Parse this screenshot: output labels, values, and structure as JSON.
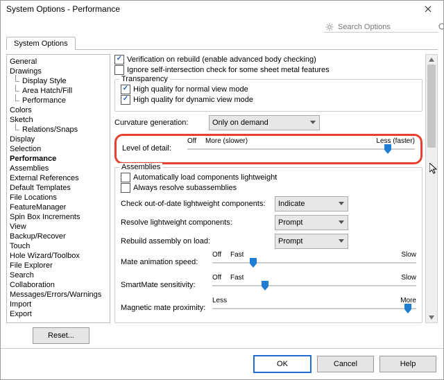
{
  "window": {
    "title": "System Options - Performance"
  },
  "search": {
    "placeholder": "Search Options"
  },
  "tabs": {
    "main": "System Options"
  },
  "tree": [
    {
      "label": "General",
      "depth": 0
    },
    {
      "label": "Drawings",
      "depth": 0
    },
    {
      "label": "Display Style",
      "depth": 1
    },
    {
      "label": "Area Hatch/Fill",
      "depth": 1
    },
    {
      "label": "Performance",
      "depth": 1
    },
    {
      "label": "Colors",
      "depth": 0
    },
    {
      "label": "Sketch",
      "depth": 0
    },
    {
      "label": "Relations/Snaps",
      "depth": 1
    },
    {
      "label": "Display",
      "depth": 0
    },
    {
      "label": "Selection",
      "depth": 0
    },
    {
      "label": "Performance",
      "depth": 0,
      "selected": true
    },
    {
      "label": "Assemblies",
      "depth": 0
    },
    {
      "label": "External References",
      "depth": 0
    },
    {
      "label": "Default Templates",
      "depth": 0
    },
    {
      "label": "File Locations",
      "depth": 0
    },
    {
      "label": "FeatureManager",
      "depth": 0
    },
    {
      "label": "Spin Box Increments",
      "depth": 0
    },
    {
      "label": "View",
      "depth": 0
    },
    {
      "label": "Backup/Recover",
      "depth": 0
    },
    {
      "label": "Touch",
      "depth": 0
    },
    {
      "label": "Hole Wizard/Toolbox",
      "depth": 0
    },
    {
      "label": "File Explorer",
      "depth": 0
    },
    {
      "label": "Search",
      "depth": 0
    },
    {
      "label": "Collaboration",
      "depth": 0
    },
    {
      "label": "Messages/Errors/Warnings",
      "depth": 0
    },
    {
      "label": "Import",
      "depth": 0
    },
    {
      "label": "Export",
      "depth": 0
    }
  ],
  "options": {
    "verification": {
      "label": "Verification on rebuild (enable advanced body checking)",
      "checked": true
    },
    "ignore_self": {
      "label": "Ignore self-intersection check for some sheet metal features",
      "checked": false
    },
    "transparency": {
      "legend": "Transparency",
      "hq_normal": {
        "label": "High quality for normal view mode",
        "checked": true
      },
      "hq_dynamic": {
        "label": "High quality for dynamic view mode",
        "checked": true
      }
    },
    "curvature": {
      "label": "Curvature generation:",
      "value": "Only on demand"
    },
    "detail": {
      "label": "Level of detail:",
      "left": "Off",
      "mid": "More (slower)",
      "right": "Less (faster)",
      "value": 88
    },
    "assemblies": {
      "legend": "Assemblies",
      "auto_light": {
        "label": "Automatically load components lightweight",
        "checked": false
      },
      "resolve_sub": {
        "label": "Always resolve subassemblies",
        "checked": false
      },
      "check_out": {
        "label": "Check out-of-date lightweight components:",
        "value": "Indicate"
      },
      "resolve_light": {
        "label": "Resolve lightweight components:",
        "value": "Prompt"
      },
      "rebuild": {
        "label": "Rebuild assembly on load:",
        "value": "Prompt"
      },
      "mate_anim": {
        "label": "Mate animation speed:",
        "left": "Off",
        "mid": "Fast",
        "right": "Slow",
        "value": 20
      },
      "smartmate": {
        "label": "SmartMate sensitivity:",
        "left": "Off",
        "mid": "Fast",
        "right": "Slow",
        "value": 26
      },
      "magnetic": {
        "label": "Magnetic mate proximity:",
        "left": "Less",
        "right": "More",
        "value": 96
      }
    }
  },
  "buttons": {
    "reset": "Reset...",
    "ok": "OK",
    "cancel": "Cancel",
    "help": "Help"
  }
}
